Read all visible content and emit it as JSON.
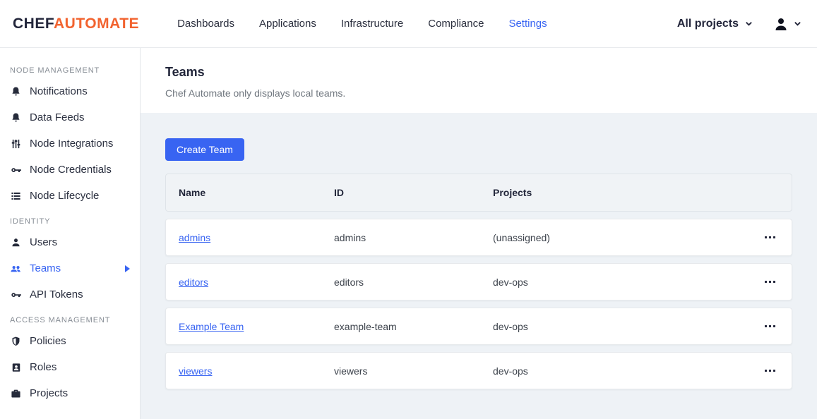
{
  "nav": {
    "logo": {
      "chef": "CHEF",
      "automate": "AUTOMATE"
    },
    "links": [
      {
        "label": "Dashboards"
      },
      {
        "label": "Applications"
      },
      {
        "label": "Infrastructure"
      },
      {
        "label": "Compliance"
      },
      {
        "label": "Settings",
        "active": true
      }
    ],
    "projects_filter": "All projects"
  },
  "sidebar": {
    "sections": [
      {
        "label": "NODE MANAGEMENT",
        "items": [
          {
            "label": "Notifications",
            "icon": "bell-icon"
          },
          {
            "label": "Data Feeds",
            "icon": "bell-icon"
          },
          {
            "label": "Node Integrations",
            "icon": "sliders-icon"
          },
          {
            "label": "Node Credentials",
            "icon": "key-icon"
          },
          {
            "label": "Node Lifecycle",
            "icon": "list-icon"
          }
        ]
      },
      {
        "label": "IDENTITY",
        "items": [
          {
            "label": "Users",
            "icon": "user-icon"
          },
          {
            "label": "Teams",
            "icon": "users-icon",
            "active": true
          },
          {
            "label": "API Tokens",
            "icon": "key-icon"
          }
        ]
      },
      {
        "label": "ACCESS MANAGEMENT",
        "items": [
          {
            "label": "Policies",
            "icon": "shield-icon"
          },
          {
            "label": "Roles",
            "icon": "badge-icon"
          },
          {
            "label": "Projects",
            "icon": "briefcase-icon"
          }
        ]
      }
    ]
  },
  "main": {
    "title": "Teams",
    "subtitle": "Chef Automate only displays local teams.",
    "create_button": "Create Team",
    "table": {
      "columns": [
        "Name",
        "ID",
        "Projects"
      ],
      "rows": [
        {
          "name": "admins",
          "id": "admins",
          "projects": "(unassigned)"
        },
        {
          "name": "editors",
          "id": "editors",
          "projects": "dev-ops"
        },
        {
          "name": "Example Team",
          "id": "example-team",
          "projects": "dev-ops"
        },
        {
          "name": "viewers",
          "id": "viewers",
          "projects": "dev-ops"
        }
      ]
    }
  },
  "colors": {
    "primary_blue": "#3864f2",
    "brand_orange": "#f2632f",
    "dark_navy": "#23263b",
    "page_background": "#eef2f6"
  }
}
